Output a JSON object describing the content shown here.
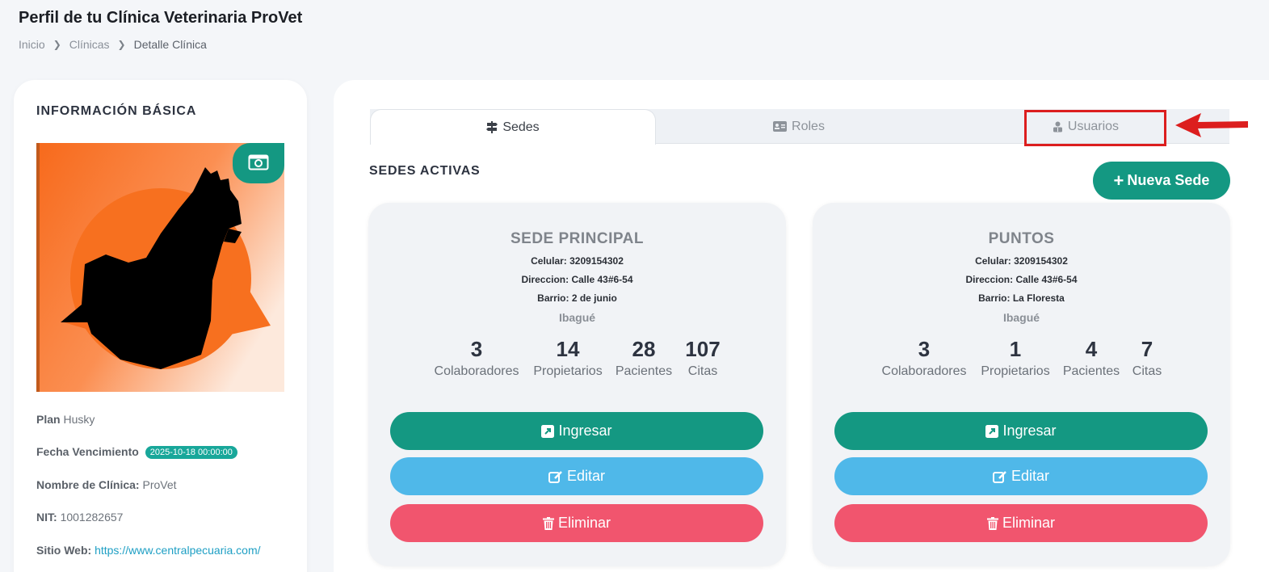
{
  "header": {
    "title": "Perfil de tu Clínica Veterinaria ProVet",
    "breadcrumb": [
      "Inicio",
      "Clínicas",
      "Detalle Clínica"
    ]
  },
  "basic_info": {
    "heading": "INFORMACIÓN BÁSICA",
    "plan_label": "Plan",
    "plan_value": "Husky",
    "expiry_label": "Fecha Vencimiento",
    "expiry_value": "2025-10-18 00:00:00",
    "clinic_name_label": "Nombre de Clínica:",
    "clinic_name_value": "ProVet",
    "nit_label": "NIT:",
    "nit_value": "1001282657",
    "website_label": "Sitio Web:",
    "website_value": "https://www.centralpecuaria.com/"
  },
  "tabs": [
    {
      "label": "Sedes",
      "icon": "signpost-icon",
      "active": true
    },
    {
      "label": "Roles",
      "icon": "id-card-icon",
      "active": false
    },
    {
      "label": "Usuarios",
      "icon": "users-icon",
      "active": false
    }
  ],
  "section_title": "SEDES ACTIVAS",
  "new_sede_label": "Nueva Sede",
  "sedes": [
    {
      "name": "SEDE PRINCIPAL",
      "phone": "Celular: 3209154302",
      "address": "Direccion: Calle 43#6-54",
      "neighborhood": "Barrio: 2 de junio",
      "city": "Ibagué",
      "stats": [
        {
          "value": "3",
          "label": "Colaboradores"
        },
        {
          "value": "14",
          "label": "Propietarios"
        },
        {
          "value": "28",
          "label": "Pacientes"
        },
        {
          "value": "107",
          "label": "Citas"
        }
      ],
      "buttons": {
        "enter": "Ingresar",
        "edit": "Editar",
        "delete": "Eliminar"
      }
    },
    {
      "name": "PUNTOS",
      "phone": "Celular: 3209154302",
      "address": "Direccion: Calle 43#6-54",
      "neighborhood": "Barrio: La Floresta",
      "city": "Ibagué",
      "stats": [
        {
          "value": "3",
          "label": "Colaboradores"
        },
        {
          "value": "1",
          "label": "Propietarios"
        },
        {
          "value": "4",
          "label": "Pacientes"
        },
        {
          "value": "7",
          "label": "Citas"
        }
      ],
      "buttons": {
        "enter": "Ingresar",
        "edit": "Editar",
        "delete": "Eliminar"
      }
    }
  ],
  "colors": {
    "primary": "#149882",
    "info": "#4fb8e9",
    "danger": "#f1556e",
    "highlight": "#dc1e1e"
  }
}
